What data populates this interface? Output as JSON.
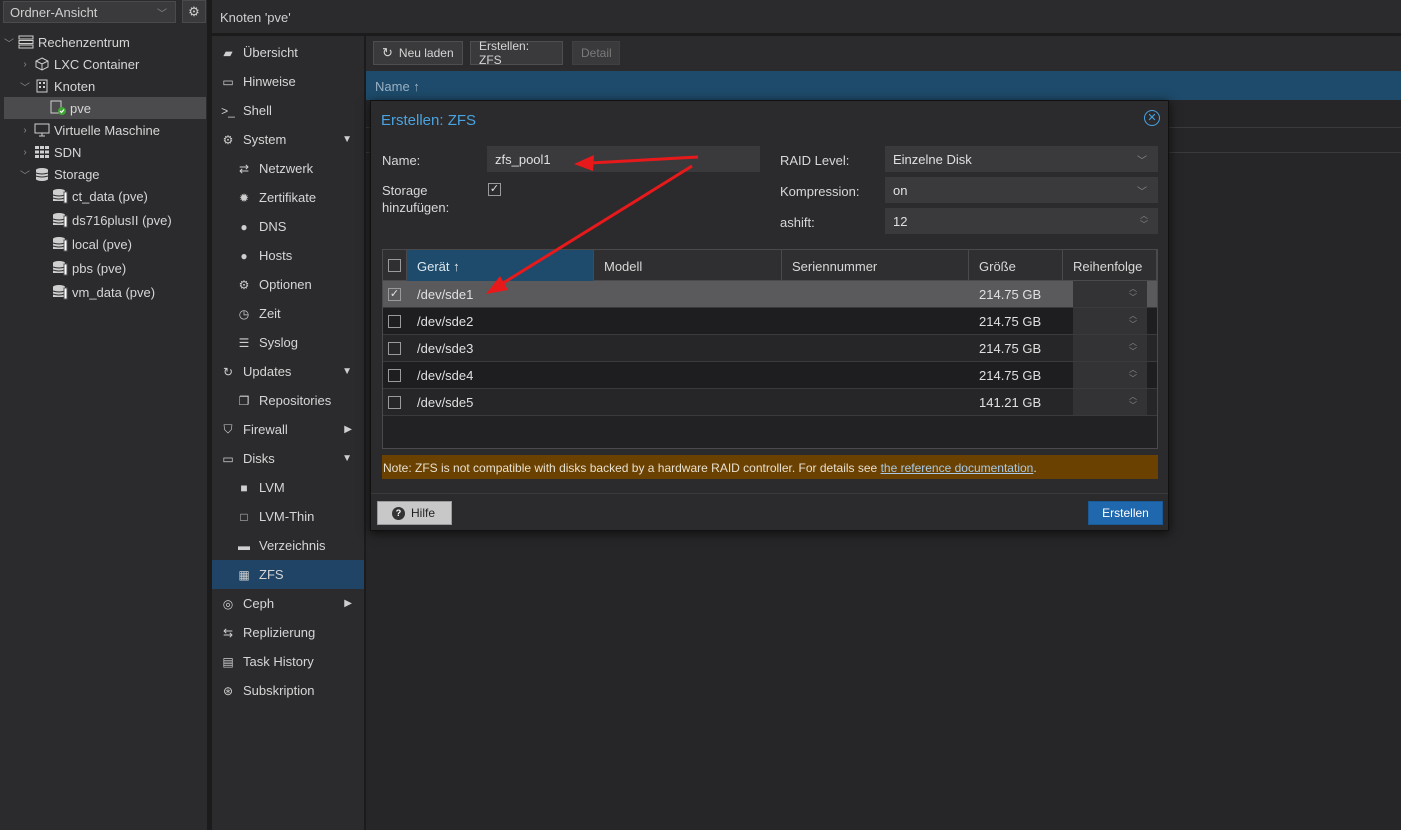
{
  "tree": {
    "view_label": "Ordner-Ansicht",
    "items": [
      {
        "label": "Rechenzentrum"
      },
      {
        "label": "LXC Container"
      },
      {
        "label": "Knoten"
      },
      {
        "label": "pve"
      },
      {
        "label": "Virtuelle Maschine"
      },
      {
        "label": "SDN"
      },
      {
        "label": "Storage"
      },
      {
        "label": "ct_data (pve)"
      },
      {
        "label": "ds716plusII (pve)"
      },
      {
        "label": "local (pve)"
      },
      {
        "label": "pbs (pve)"
      },
      {
        "label": "vm_data (pve)"
      }
    ]
  },
  "header": {
    "title": "Knoten 'pve'"
  },
  "nav": {
    "items": [
      {
        "label": "Übersicht"
      },
      {
        "label": "Hinweise"
      },
      {
        "label": "Shell"
      },
      {
        "label": "System"
      },
      {
        "label": "Netzwerk"
      },
      {
        "label": "Zertifikate"
      },
      {
        "label": "DNS"
      },
      {
        "label": "Hosts"
      },
      {
        "label": "Optionen"
      },
      {
        "label": "Zeit"
      },
      {
        "label": "Syslog"
      },
      {
        "label": "Updates"
      },
      {
        "label": "Repositories"
      },
      {
        "label": "Firewall"
      },
      {
        "label": "Disks"
      },
      {
        "label": "LVM"
      },
      {
        "label": "LVM-Thin"
      },
      {
        "label": "Verzeichnis"
      },
      {
        "label": "ZFS"
      },
      {
        "label": "Ceph"
      },
      {
        "label": "Replizierung"
      },
      {
        "label": "Task History"
      },
      {
        "label": "Subskription"
      }
    ]
  },
  "toolbar": {
    "reload_label": "Neu laden",
    "create_zfs_label": "Erstellen: ZFS",
    "detail_label": "Detail"
  },
  "grid": {
    "name_header": "Name ↑"
  },
  "dialog": {
    "title": "Erstellen: ZFS",
    "name_label": "Name:",
    "name_value": "zfs_pool1",
    "storage_label_1": "Storage",
    "storage_label_2": "hinzufügen:",
    "raid_label": "RAID Level:",
    "raid_value": "Einzelne Disk",
    "compression_label": "Kompression:",
    "compression_value": "on",
    "ashift_label": "ashift:",
    "ashift_value": "12",
    "columns": {
      "device": "Gerät ↑",
      "model": "Modell",
      "serial": "Seriennummer",
      "size": "Größe",
      "order": "Reihenfolge"
    },
    "disks": [
      {
        "device": "/dev/sde1",
        "size": "214.75 GB",
        "checked": true
      },
      {
        "device": "/dev/sde2",
        "size": "214.75 GB",
        "checked": false
      },
      {
        "device": "/dev/sde3",
        "size": "214.75 GB",
        "checked": false
      },
      {
        "device": "/dev/sde4",
        "size": "214.75 GB",
        "checked": false
      },
      {
        "device": "/dev/sde5",
        "size": "141.21 GB",
        "checked": false
      }
    ],
    "note_text": "Note: ZFS is not compatible with disks backed by a hardware RAID controller. For details see ",
    "note_link": "the reference documentation",
    "note_end": ".",
    "help_label": "Hilfe",
    "create_label": "Erstellen"
  },
  "colors": {
    "accent": "#4aa3e0",
    "selected": "#1f4466",
    "note_bg": "#6a4100",
    "primary_button": "#1f68ad",
    "annotation_arrow": "#e8191b"
  }
}
